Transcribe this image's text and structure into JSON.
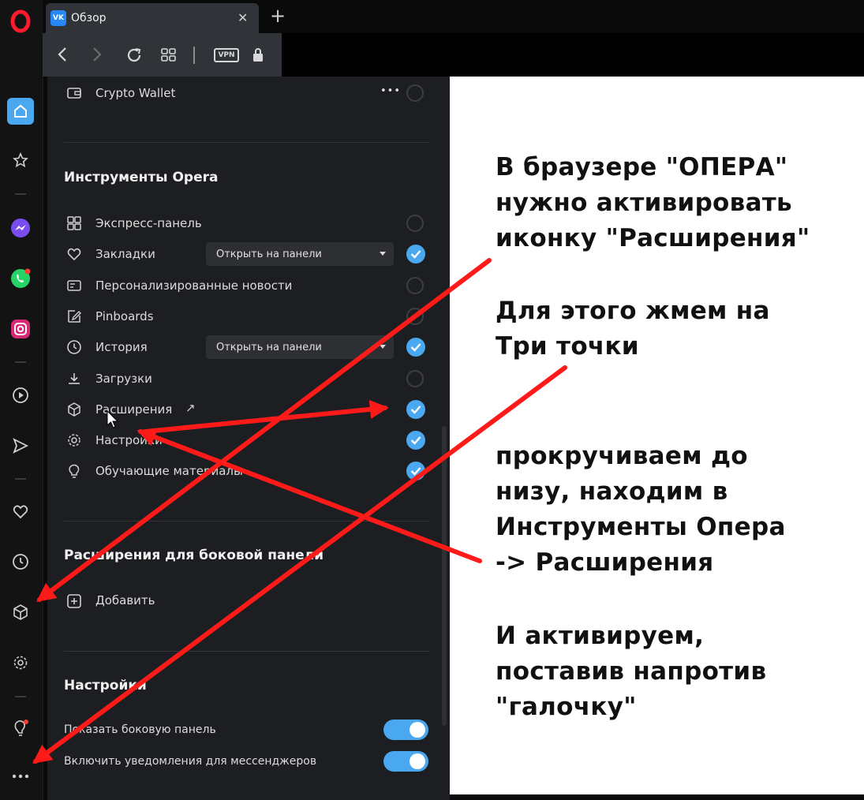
{
  "tab": {
    "favicon": "VK",
    "title": "Обзор",
    "close": "✕",
    "new_tab": "+"
  },
  "toolbar": {
    "vpn": "VPN"
  },
  "panel": {
    "crypto_wallet": "Crypto Wallet",
    "more_dots": "•••",
    "tools_title": "Инструменты Opera",
    "tools": [
      {
        "label": "Экспресс-панель",
        "icon": "grid-icon",
        "state": "off"
      },
      {
        "label": "Закладки",
        "icon": "heart-icon",
        "state": "on",
        "select": "Открыть на панели"
      },
      {
        "label": "Персонализированные новости",
        "icon": "news-icon",
        "state": "off"
      },
      {
        "label": "Pinboards",
        "icon": "pinboard-icon",
        "state": "off"
      },
      {
        "label": "История",
        "icon": "clock-icon",
        "state": "on",
        "select": "Открыть на панели"
      },
      {
        "label": "Загрузки",
        "icon": "download-icon",
        "state": "off"
      },
      {
        "label": "Расширения",
        "icon": "cube-icon",
        "state": "on",
        "external": "↗"
      },
      {
        "label": "Настройки",
        "icon": "gear-icon",
        "state": "on"
      },
      {
        "label": "Обучающие материалы",
        "icon": "bulb-icon",
        "state": "on"
      }
    ],
    "sidebar_ext_title": "Расширения для боковой панели",
    "add_label": "Добавить",
    "settings_title": "Настройки",
    "toggles": [
      {
        "label": "Показать боковую панель",
        "on": true
      },
      {
        "label": "Включить уведомления для мессенджеров",
        "on": true
      }
    ]
  },
  "annotation": [
    "В браузере \"ОПЕРА\"\nнужно активировать\nиконку \"Расширения\"",
    "Для этого жмем на\nТри точки",
    "прокручиваем до\nнизу, находим в\nИнструменты Опера\n-> Расширения",
    "И активируем,\nпоставив напротив\n\"галочку\""
  ],
  "colors": {
    "accent": "#4aa8f0",
    "arrow": "#ff1a1a",
    "opera": "#ff1b2d"
  }
}
